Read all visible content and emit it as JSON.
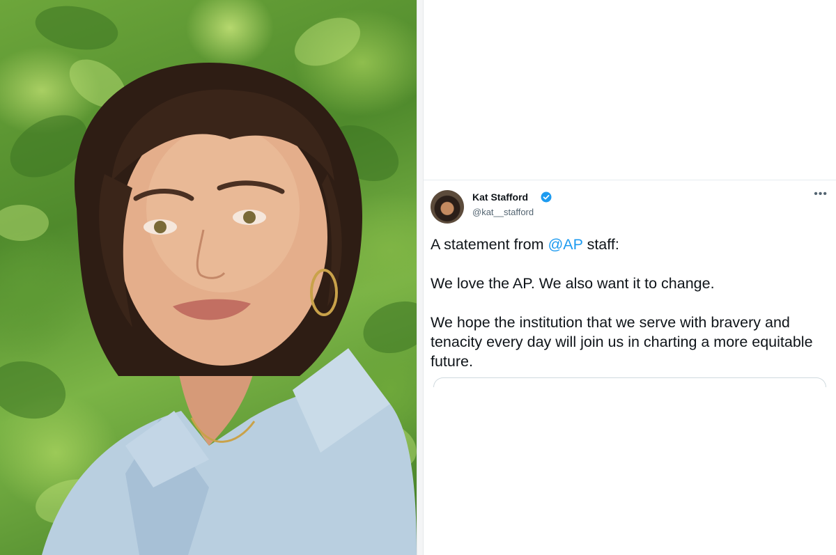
{
  "tweet": {
    "author_name": "Kat Stafford",
    "author_handle": "@kat__stafford",
    "verified": true,
    "more_icon": "more-horizontal-icon",
    "text_prefix": "A statement from ",
    "mention": "@AP",
    "text_suffix": " staff:",
    "paragraph_2": "We love the AP. We also want it to change.",
    "paragraph_3": "We hope the institution that we serve with bravery and tenacity every day will join us in charting a more equitable future."
  },
  "colors": {
    "mention": "#1d9bf0",
    "verified_badge": "#1d9bf0",
    "text": "#0f1419",
    "secondary_text": "#536471"
  }
}
